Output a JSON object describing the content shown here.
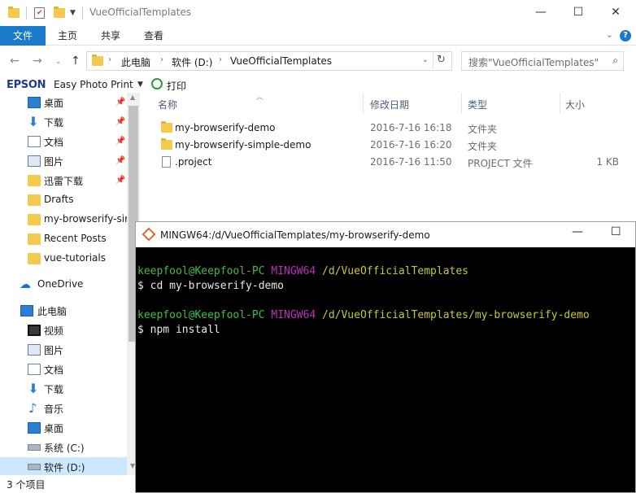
{
  "window": {
    "title": "VueOfficialTemplates",
    "minimize": "—",
    "maximize": "☐",
    "close": "✕"
  },
  "ribbon": {
    "file_tab": "文件",
    "tabs": [
      "主页",
      "共享",
      "查看"
    ],
    "help": "?"
  },
  "address": {
    "crumbs": [
      "此电脑",
      "软件 (D:)",
      "VueOfficialTemplates"
    ],
    "search_placeholder": "搜索\"VueOfficialTemplates\""
  },
  "epson": {
    "logo": "EPSON",
    "app": "Easy Photo Print",
    "print": "打印"
  },
  "sidebar": {
    "items": [
      {
        "label": "桌面",
        "icon": "desktop-icon",
        "pinned": true
      },
      {
        "label": "下载",
        "icon": "download-icon",
        "pinned": true
      },
      {
        "label": "文档",
        "icon": "document-icon",
        "pinned": true
      },
      {
        "label": "图片",
        "icon": "picture-icon",
        "pinned": true
      },
      {
        "label": "迅雷下载",
        "icon": "folder-icon",
        "pinned": true
      },
      {
        "label": "Drafts",
        "icon": "folder-icon",
        "pinned": false
      },
      {
        "label": "my-browserify-sir",
        "icon": "folder-icon",
        "pinned": false
      },
      {
        "label": "Recent Posts",
        "icon": "folder-icon",
        "pinned": false
      },
      {
        "label": "vue-tutorials",
        "icon": "folder-icon",
        "pinned": false
      },
      {
        "label": "OneDrive",
        "icon": "cloud-icon",
        "pinned": false
      },
      {
        "label": "此电脑",
        "icon": "computer-icon",
        "pinned": false
      },
      {
        "label": "视频",
        "icon": "video-icon",
        "pinned": false
      },
      {
        "label": "图片",
        "icon": "picture-icon",
        "pinned": false
      },
      {
        "label": "文档",
        "icon": "document-icon",
        "pinned": false
      },
      {
        "label": "下载",
        "icon": "download-icon",
        "pinned": false
      },
      {
        "label": "音乐",
        "icon": "music-icon",
        "pinned": false
      },
      {
        "label": "桌面",
        "icon": "desktop-icon",
        "pinned": false
      },
      {
        "label": "系统 (C:)",
        "icon": "drive-icon",
        "pinned": false
      },
      {
        "label": "软件 (D:)",
        "icon": "drive-icon",
        "pinned": false,
        "selected": true
      }
    ]
  },
  "columns": {
    "name": "名称",
    "date": "修改日期",
    "type": "类型",
    "size": "大小"
  },
  "files": [
    {
      "name": "my-browserify-demo",
      "date": "2016-7-16 16:18",
      "type": "文件夹",
      "size": "",
      "icon": "folder-icon"
    },
    {
      "name": "my-browserify-simple-demo",
      "date": "2016-7-16 16:20",
      "type": "文件夹",
      "size": "",
      "icon": "folder-icon"
    },
    {
      "name": ".project",
      "date": "2016-7-16 11:50",
      "type": "PROJECT 文件",
      "size": "1 KB",
      "icon": "file-icon"
    }
  ],
  "status": {
    "count": "3 个项目"
  },
  "terminal": {
    "title": "MINGW64:/d/VueOfficialTemplates/my-browserify-demo",
    "lines": [
      {
        "user": "keepfool@Keepfool-PC",
        "env": "MINGW64",
        "path": "/d/VueOfficialTemplates"
      },
      {
        "cmd": "$ cd my-browserify-demo"
      },
      {
        "user": "keepfool@Keepfool-PC",
        "env": "MINGW64",
        "path": "/d/VueOfficialTemplates/my-browserify-demo"
      },
      {
        "cmd": "$ npm install"
      }
    ]
  },
  "colors": {
    "accent": "#1979ca",
    "term_user": "#3fbf3f",
    "term_env": "#c02cc0",
    "term_path": "#c8c82c"
  }
}
